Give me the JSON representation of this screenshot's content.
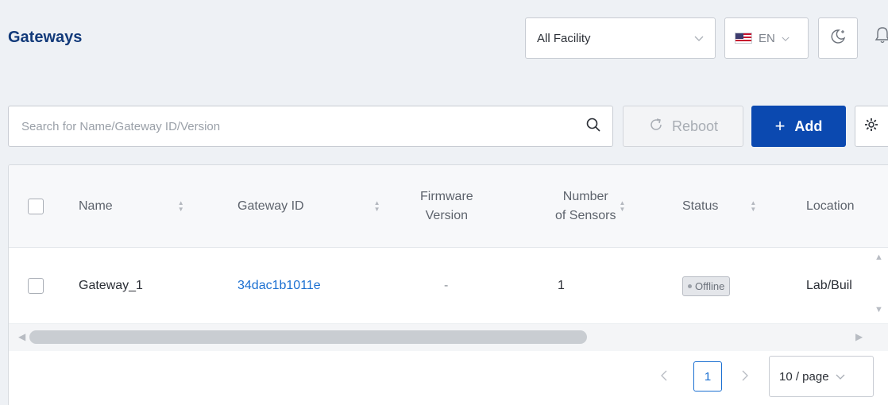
{
  "header": {
    "title": "Gateways",
    "facility_select": "All Facility",
    "language": "EN"
  },
  "toolbar": {
    "search_placeholder": "Search for Name/Gateway ID/Version",
    "reboot_label": "Reboot",
    "add_label": "Add"
  },
  "table": {
    "columns": {
      "name": "Name",
      "gateway_id": "Gateway ID",
      "firmware_line1": "Firmware",
      "firmware_line2": "Version",
      "sensors_line1": "Number",
      "sensors_line2": "of Sensors",
      "status": "Status",
      "location": "Location"
    },
    "rows": [
      {
        "name": "Gateway_1",
        "gateway_id": "34dac1b1011e",
        "firmware": "-",
        "sensors": "1",
        "status": "Offline",
        "location": "Lab/Buil"
      }
    ]
  },
  "pagination": {
    "current_page": "1",
    "page_size": "10 / page"
  },
  "colors": {
    "title": "#123a7a",
    "primary": "#0b49b0",
    "link": "#1a6fd1"
  }
}
